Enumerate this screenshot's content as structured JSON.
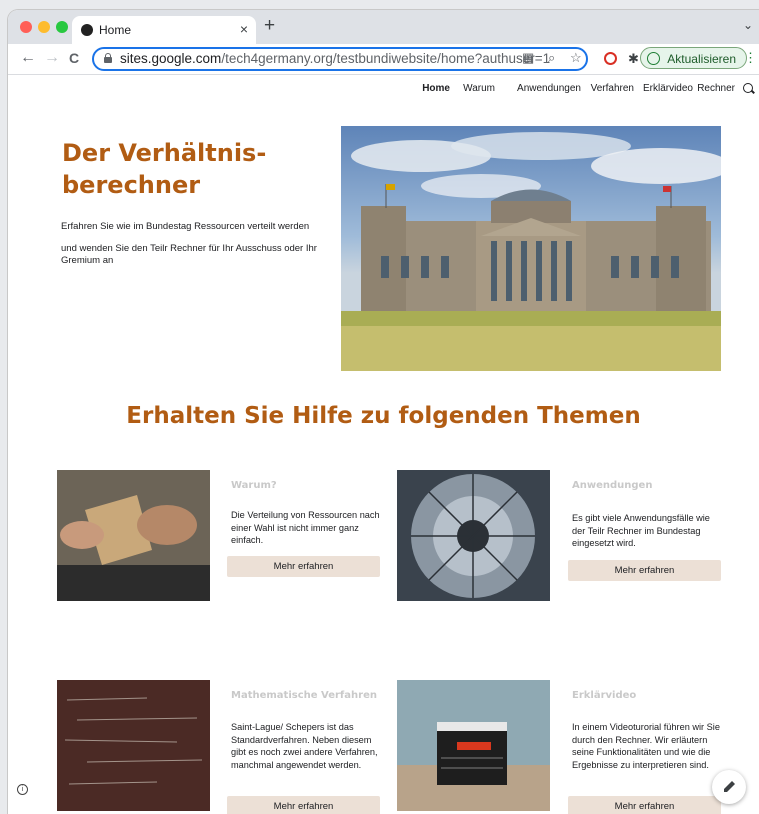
{
  "browser": {
    "tab_title": "Home",
    "tab_close": "×",
    "new_tab": "+",
    "tab_menu": "⌄",
    "back": "←",
    "forward": "→",
    "reload": "C",
    "url_domain": "sites.google.com",
    "url_path": "/tech4germany.org/testbundiwebsite/home?authuser=1",
    "update_label": "Aktualisieren",
    "menu": "⋮",
    "icons": [
      "lock-icon",
      "qr-code-icon",
      "zoom-icon",
      "star-icon",
      "extension-icon",
      "puzzle-icon",
      "profile-avatar-icon"
    ]
  },
  "site": {
    "nav": [
      "Home",
      "Warum",
      "Anwendungen",
      "Verfahren",
      "Erklärvideo",
      "Rechner"
    ],
    "hero": {
      "title": "Der Verhältnis-berechner",
      "line1": "Erfahren Sie wie im Bundestag Ressourcen verteilt werden",
      "line2": "und wenden Sie den Teilr Rechner für Ihr Ausschuss oder Ihr Gremium an"
    },
    "section_title": "Erhalten Sie Hilfe zu folgenden Themen",
    "cards": [
      {
        "title": "Warum?",
        "text": "Die Verteilung von Ressourcen nach einer Wahl ist nicht immer ganz einfach.",
        "button": "Mehr erfahren"
      },
      {
        "title": "Anwendungen",
        "text": "Es gibt viele Anwendungsfälle wie der Teilr Rechner im Bundestag eingesetzt wird.",
        "button": "Mehr erfahren"
      },
      {
        "title": "Mathematische Verfahren",
        "text": "Saint-Lague/ Schepers ist das Standardverfahren. Neben diesem gibt es noch zwei andere Verfahren, manchmal angewendet werden.",
        "button": "Mehr erfahren"
      },
      {
        "title": "Erklärvideo",
        "text": "In einem Videoturorial führen wir Sie durch den Rechner. Wir erläutern seine Funktionalitäten und wie die Ergebnisse zu interpretieren sind.",
        "button": "Mehr erfahren"
      }
    ],
    "info_glyph": "i",
    "colors": {
      "accent": "#b15c13",
      "button_bg": "#ece0d6",
      "card_title": "#c9c9c9"
    }
  }
}
